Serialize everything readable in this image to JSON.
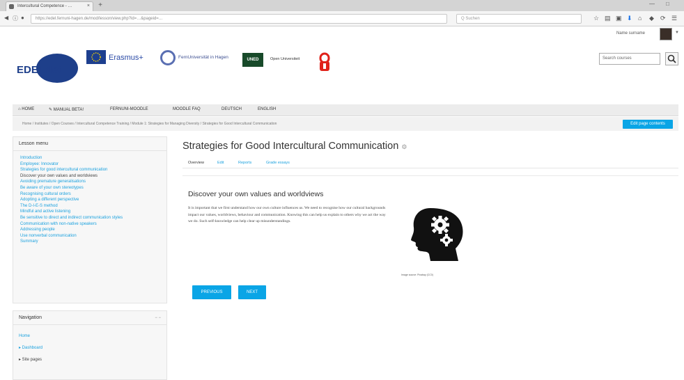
{
  "browser": {
    "tab_title": "Intercultural Competence - …",
    "tab_close": "×",
    "new_tab": "+",
    "url": "https://edel.fernuni-hagen.de/mod/lesson/view.php?id=…&pageid=…",
    "search_placeholder": "Q Suchen",
    "window_controls": [
      "—",
      "□"
    ]
  },
  "header": {
    "user_name": "Name surname",
    "edelnet_text": "EDELNet",
    "erasmus_text": "Erasmus+",
    "fernuni_text": "FernUniversität in Hagen",
    "uned_text": "UNED",
    "ou_text": "Open Universiteit",
    "course_search_placeholder": "Search courses"
  },
  "navbar": {
    "items": [
      "⌂ HOME",
      "✎ MANUAL BETA!",
      "FERNUNI-MOODLE",
      "MOODLE FAQ",
      "DEUTSCH",
      "ENGLISH"
    ]
  },
  "breadcrumb": "Home  /  Institutes  /  Open Courses  /  Intercultural Competence Training  /  Module 1: Strategies for Managing Diversity  /  Strategies for Good Intercultural Communication",
  "edit_button": "Edit page contents",
  "lesson_menu": {
    "title": "Lesson menu",
    "items": [
      "Introduction",
      "Employee: Innovator",
      "Strategies for good intercultural communication",
      "Discover your own values and worldviews",
      "Avoiding premature generalisations",
      "Be aware of your own stereotypes",
      "Recognising cultural orders",
      "Adopting a different perspective",
      "The D-I-E-S method",
      "Mindful and active listening",
      "Be sensitive to direct and indirect communication styles",
      "Communication with non-native speakers",
      "Addressing people",
      "Use nonverbal communication",
      "Summary"
    ],
    "current_index": 3
  },
  "navigation": {
    "title": "Navigation",
    "collapse": "− −",
    "links": [
      "Home",
      "▸  Dashboard",
      "▸  Site pages"
    ]
  },
  "main": {
    "title": "Strategies for Good Intercultural Communication",
    "title_icon": "⚙",
    "tabs": [
      "Overview",
      "Edit",
      "Reports",
      "Grade essays"
    ],
    "heading": "Discover your own values and worldviews",
    "paragraph": "It is important that we first understand how our own culture influences us. We need to recognise how our cultural backgrounds impact our values, worldviews, behaviour and communication. Knowing this can help us explain to others why we act the way we do. Such self-knowledge can help clear up misunderstandings.",
    "image_caption": "Image source: Pixabay (CC0)",
    "previous_button": "PREVIOUS",
    "next_button": "NEXT"
  },
  "colors": {
    "accent": "#0aa5e6",
    "link": "#1ba1de"
  }
}
